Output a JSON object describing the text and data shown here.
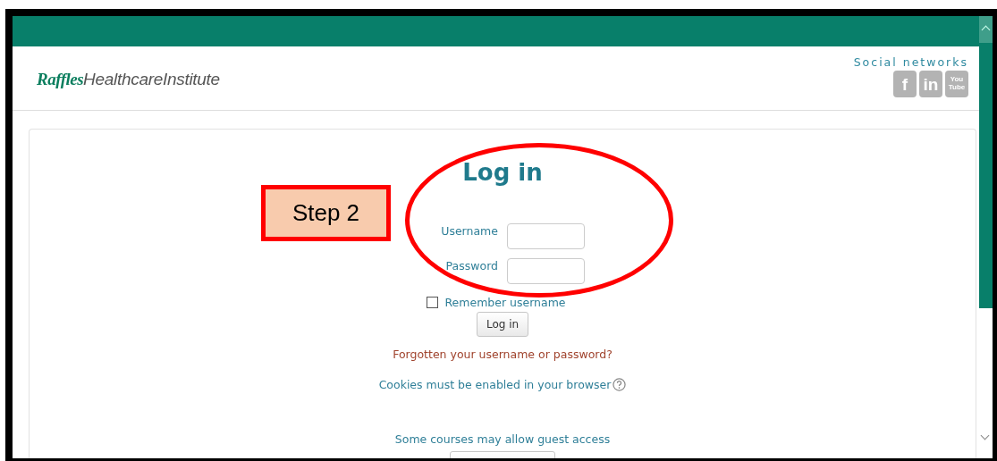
{
  "header": {
    "logo": {
      "brand": "Raffles",
      "name": "HealthcareInstitute"
    },
    "social": {
      "title": "Social networks",
      "icons": [
        {
          "label": "f"
        },
        {
          "label": "in"
        },
        {
          "label": "You Tube"
        }
      ]
    }
  },
  "login": {
    "title": "Log in",
    "fields": [
      {
        "label": "Username"
      },
      {
        "label": "Password"
      }
    ],
    "remember": {
      "label": "Remember username",
      "checked": false
    },
    "button": "Log in",
    "forgot": "Forgotten your username or password?",
    "cookies": "Cookies must be enabled in your browser",
    "guest": "Some courses may allow guest access"
  },
  "annotation": {
    "label": "Step 2"
  }
}
